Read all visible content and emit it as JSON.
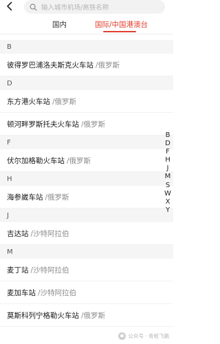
{
  "search": {
    "placeholder": "输入城市机场/高铁名称"
  },
  "tabs": [
    {
      "label": "国内",
      "active": false
    },
    {
      "label": "国际/中国港澳台",
      "active": true
    }
  ],
  "accent_color": "#e0402f",
  "sections": [
    {
      "letter": "B",
      "items": [
        {
          "name": "彼得罗巴浦洛夫斯克火车站",
          "country": "/俄罗斯"
        }
      ]
    },
    {
      "letter": "D",
      "items": [
        {
          "name": "东方港火车站",
          "country": "/俄罗斯"
        },
        {
          "name": "顿河畔罗斯托夫火车站",
          "country": "/俄罗斯"
        }
      ]
    },
    {
      "letter": "F",
      "items": [
        {
          "name": "伏尔加格勒火车站",
          "country": "/俄罗斯"
        }
      ]
    },
    {
      "letter": "H",
      "items": [
        {
          "name": "海参崴车站",
          "country": "/俄罗斯"
        }
      ]
    },
    {
      "letter": "J",
      "items": [
        {
          "name": "吉达站",
          "country": "/沙特阿拉伯"
        }
      ]
    },
    {
      "letter": "M",
      "items": [
        {
          "name": "麦丁站",
          "country": "/沙特阿拉伯"
        },
        {
          "name": "麦加车站",
          "country": "/沙特阿拉伯"
        },
        {
          "name": "莫斯科列宁格勒火车站",
          "country": "/俄罗斯"
        }
      ]
    }
  ],
  "index_letters": [
    "B",
    "D",
    "F",
    "H",
    "J",
    "M",
    "S",
    "W",
    "X",
    "Y"
  ],
  "watermark": "公众号 · 青蛙飞跳"
}
